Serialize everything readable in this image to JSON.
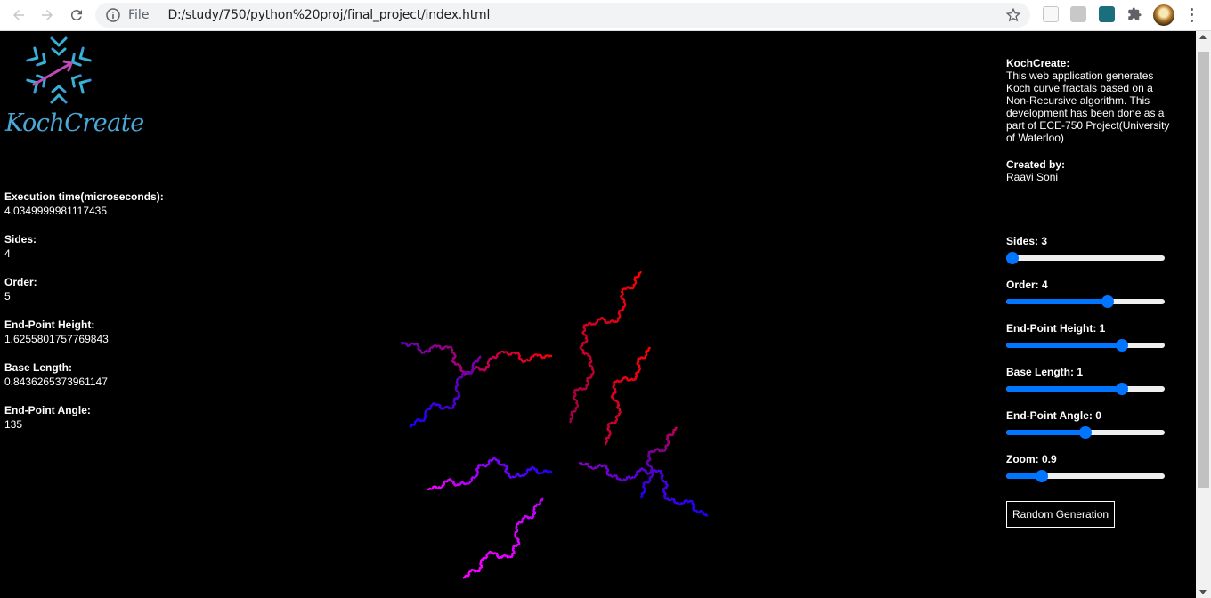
{
  "browser": {
    "scheme_label": "File",
    "url": "D:/study/750/python%20proj/final_project/index.html"
  },
  "logo": {
    "text": "KochCreate"
  },
  "stats": [
    {
      "label": "Execution time(microseconds):",
      "value": "4.0349999981117435"
    },
    {
      "label": "Sides:",
      "value": "4"
    },
    {
      "label": "Order:",
      "value": "5"
    },
    {
      "label": "End-Point Height:",
      "value": "1.6255801757769843"
    },
    {
      "label": "Base Length:",
      "value": "0.8436265373961147"
    },
    {
      "label": "End-Point Angle:",
      "value": "135"
    }
  ],
  "about": {
    "title": "KochCreate:",
    "description": "This web application generates Koch curve fractals based on a Non-Recursive algorithm. This development has been done as a part of ECE-750 Project(University of Waterloo)",
    "created_by_label": "Created by:",
    "author": "Raavi Soni"
  },
  "controls": [
    {
      "label": "Sides:",
      "value": "3",
      "level": 0.0
    },
    {
      "label": "Order:",
      "value": "4",
      "level": 0.65
    },
    {
      "label": "End-Point Height:",
      "value": "1",
      "level": 0.75
    },
    {
      "label": "Base Length:",
      "value": "1",
      "level": 0.75
    },
    {
      "label": "End-Point Angle:",
      "value": "0",
      "level": 0.5
    },
    {
      "label": "Zoom:",
      "value": "0.9",
      "level": 0.2
    }
  ],
  "random_button_label": "Random Generation",
  "colors": {
    "accent": "#0075ff",
    "fractal_red": "#ff0000",
    "fractal_blue": "#1a00ff",
    "fractal_magenta": "#ff00ff"
  }
}
